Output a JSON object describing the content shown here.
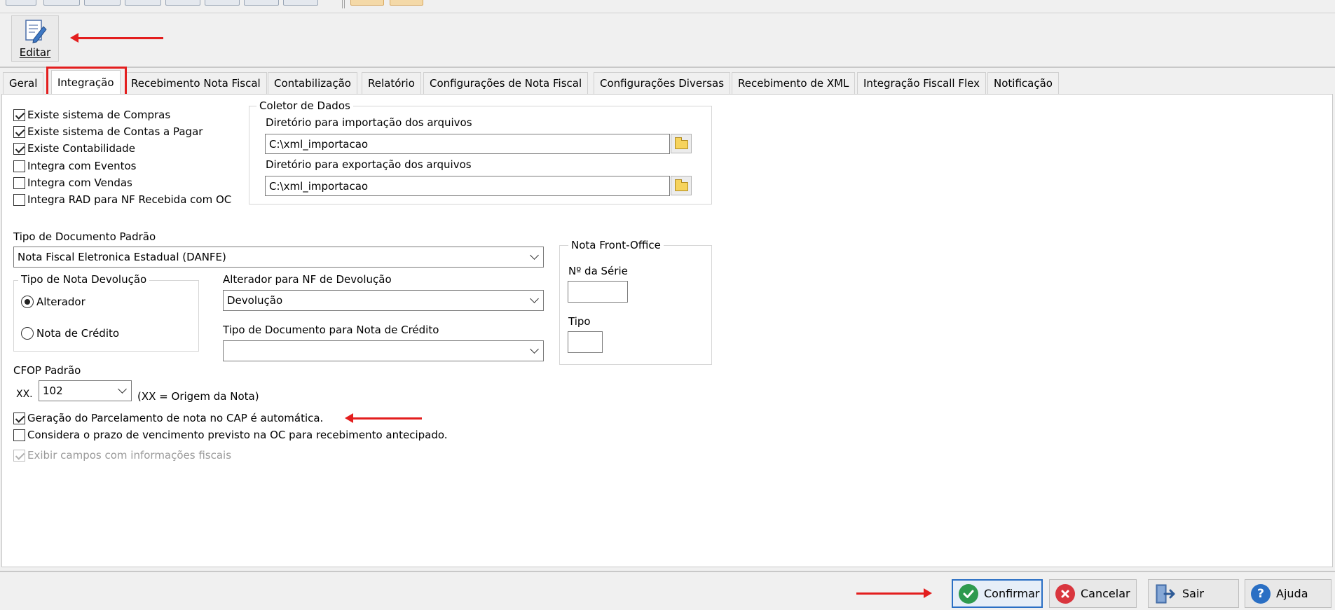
{
  "toolbar": {
    "edit_label": "Editar"
  },
  "tabs": [
    "Geral",
    "Integração",
    "Recebimento Nota Fiscal",
    "Contabilização",
    "Relatório",
    "Configurações de Nota Fiscal",
    "Configurações Diversas",
    "Recebimento de XML",
    "Integração Fiscall Flex",
    "Notificação"
  ],
  "active_tab": "Integração",
  "options": [
    {
      "label": "Existe sistema de Compras",
      "checked": true
    },
    {
      "label": "Existe sistema de Contas a Pagar",
      "checked": true
    },
    {
      "label": "Existe Contabilidade",
      "checked": true
    },
    {
      "label": "Integra com Eventos",
      "checked": false
    },
    {
      "label": "Integra com Vendas",
      "checked": false
    },
    {
      "label": "Integra RAD para NF Recebida com OC",
      "checked": false
    }
  ],
  "coletor": {
    "title": "Coletor de Dados",
    "import_label": "Diretório para importação dos arquivos",
    "import_value": "C:\\xml_importacao",
    "export_label": "Diretório para exportação dos arquivos",
    "export_value": "C:\\xml_importacao"
  },
  "tipo_documento": {
    "label": "Tipo de Documento Padrão",
    "value": "Nota Fiscal Eletronica Estadual (DANFE)"
  },
  "tipo_nota_devolucao": {
    "title": "Tipo de Nota Devolução",
    "options": [
      {
        "label": "Alterador",
        "selected": true
      },
      {
        "label": "Nota de Crédito",
        "selected": false
      }
    ]
  },
  "alterador": {
    "label": "Alterador para NF de Devolução",
    "value": "Devolução"
  },
  "tipo_doc_credito": {
    "label": "Tipo de Documento para Nota de Crédito",
    "value": ""
  },
  "front_office": {
    "title": "Nota Front-Office",
    "serie_label": "Nº da Série",
    "serie_value": "",
    "tipo_label": "Tipo",
    "tipo_value": ""
  },
  "cfop": {
    "label": "CFOP Padrão",
    "prefix": "XX.",
    "value": "102",
    "hint": "(XX = Origem da Nota)"
  },
  "bottom_options": [
    {
      "label": "Geração do Parcelamento de nota no CAP é automática.",
      "checked": true,
      "disabled": false
    },
    {
      "label": "Considera o prazo de vencimento previsto na OC para recebimento antecipado.",
      "checked": false,
      "disabled": false
    },
    {
      "label": "Exibir campos com informações fiscais",
      "checked": true,
      "disabled": true
    }
  ],
  "buttons": {
    "confirm": "Confirmar",
    "cancel": "Cancelar",
    "exit": "Sair",
    "help": "Ajuda"
  },
  "colors": {
    "annotation": "#e31e1e",
    "confirm_icon": "#2e9a4f",
    "cancel_icon": "#d9363e",
    "help_icon": "#2a6fc4",
    "focus_border": "#2a6fc4"
  }
}
